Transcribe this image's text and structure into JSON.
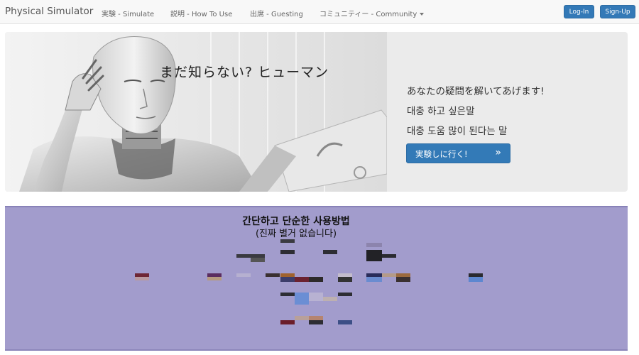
{
  "navbar": {
    "brand": "Physical Simulator",
    "links": [
      "実験 - Simulate",
      "説明 - How To Use",
      "出席 - Guesting",
      "コミュニティー - Community"
    ],
    "login": "Log-In",
    "signup": "Sign-Up"
  },
  "hero": {
    "caption": "まだ知らない? ヒューマン",
    "lines": [
      "あなたの疑問を解いてあげます!",
      "대충 하고 싶은말",
      "대충 도움 많이 된다는 말"
    ],
    "cta_label": "実験しに行く!",
    "cta_icon": "»"
  },
  "usage": {
    "title": "간단하고 단순한 사용방법",
    "subtitle": "(진짜 별거 없습니다)"
  },
  "colors": {
    "accent": "#337ab7",
    "usage_bg": "#a29ccc"
  }
}
